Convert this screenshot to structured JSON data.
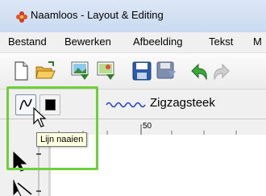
{
  "window": {
    "title": "Naamloos - Layout & Editing"
  },
  "menu": {
    "items": [
      "Bestand",
      "Bewerken",
      "Afbeelding",
      "Tekst",
      "M"
    ]
  },
  "toolbar": {
    "icons": [
      "new-document-icon",
      "open-folder-icon",
      "import-image-icon",
      "import-image-2-icon",
      "save-icon",
      "save-as-icon",
      "undo-icon",
      "redo-icon"
    ]
  },
  "stitch_bar": {
    "line_sew_tooltip": "Lijn naaien",
    "stitch_type_label": "Zigzagsteek"
  },
  "ruler": {
    "tick_label": "50"
  },
  "colors": {
    "highlight": "#6fcf3a",
    "stitch_wave": "#1e3cc8",
    "tooltip_bg": "#ffffe1"
  }
}
